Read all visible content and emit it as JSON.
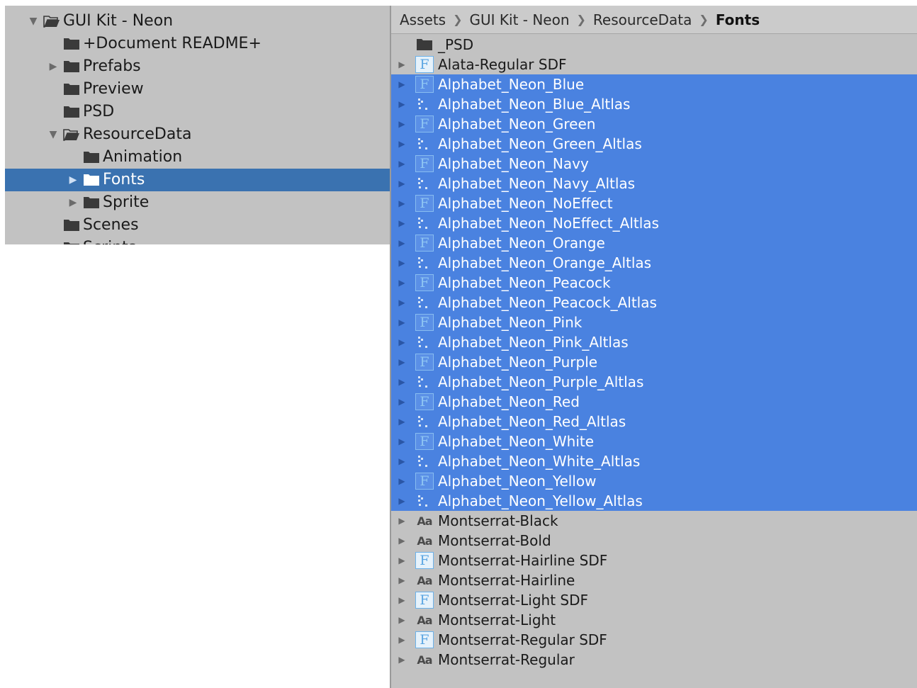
{
  "tree": {
    "items": [
      {
        "label": "GUI Kit - Neon",
        "indent": 0,
        "expander": "down",
        "open": true,
        "selected": false
      },
      {
        "label": "+Document README+",
        "indent": 1,
        "expander": "none",
        "open": false,
        "selected": false
      },
      {
        "label": "Prefabs",
        "indent": 1,
        "expander": "right",
        "open": false,
        "selected": false
      },
      {
        "label": "Preview",
        "indent": 1,
        "expander": "none",
        "open": false,
        "selected": false
      },
      {
        "label": "PSD",
        "indent": 1,
        "expander": "none",
        "open": false,
        "selected": false
      },
      {
        "label": "ResourceData",
        "indent": 1,
        "expander": "down",
        "open": true,
        "selected": false
      },
      {
        "label": "Animation",
        "indent": 2,
        "expander": "none",
        "open": false,
        "selected": false
      },
      {
        "label": "Fonts",
        "indent": 2,
        "expander": "right",
        "open": false,
        "selected": true
      },
      {
        "label": "Sprite",
        "indent": 2,
        "expander": "right",
        "open": false,
        "selected": false
      },
      {
        "label": "Scenes",
        "indent": 1,
        "expander": "none",
        "open": false,
        "selected": false
      },
      {
        "label": "Scripts",
        "indent": 1,
        "expander": "none",
        "open": false,
        "selected": false
      }
    ]
  },
  "breadcrumb": [
    "Assets",
    "GUI Kit - Neon",
    "ResourceData",
    "Fonts"
  ],
  "assets": [
    {
      "label": "_PSD",
      "icon": "folder-icon",
      "expander": false,
      "selected": false
    },
    {
      "label": "Alata-Regular SDF",
      "icon": "font-asset-icon",
      "expander": true,
      "selected": false
    },
    {
      "label": "Alphabet_Neon_Blue",
      "icon": "font-asset-icon",
      "expander": true,
      "selected": true
    },
    {
      "label": "Alphabet_Neon_Blue_Altlas",
      "icon": "atlas-texture-icon",
      "expander": true,
      "selected": true
    },
    {
      "label": "Alphabet_Neon_Green",
      "icon": "font-asset-icon",
      "expander": true,
      "selected": true
    },
    {
      "label": "Alphabet_Neon_Green_Altlas",
      "icon": "atlas-texture-icon",
      "expander": true,
      "selected": true
    },
    {
      "label": "Alphabet_Neon_Navy",
      "icon": "font-asset-icon",
      "expander": true,
      "selected": true
    },
    {
      "label": "Alphabet_Neon_Navy_Altlas",
      "icon": "atlas-texture-icon",
      "expander": true,
      "selected": true
    },
    {
      "label": "Alphabet_Neon_NoEffect",
      "icon": "font-asset-icon",
      "expander": true,
      "selected": true
    },
    {
      "label": "Alphabet_Neon_NoEffect_Altlas",
      "icon": "atlas-texture-icon",
      "expander": true,
      "selected": true
    },
    {
      "label": "Alphabet_Neon_Orange",
      "icon": "font-asset-icon",
      "expander": true,
      "selected": true
    },
    {
      "label": "Alphabet_Neon_Orange_Altlas",
      "icon": "atlas-texture-icon",
      "expander": true,
      "selected": true
    },
    {
      "label": "Alphabet_Neon_Peacock",
      "icon": "font-asset-icon",
      "expander": true,
      "selected": true
    },
    {
      "label": "Alphabet_Neon_Peacock_Altlas",
      "icon": "atlas-texture-icon",
      "expander": true,
      "selected": true
    },
    {
      "label": "Alphabet_Neon_Pink",
      "icon": "font-asset-icon",
      "expander": true,
      "selected": true
    },
    {
      "label": "Alphabet_Neon_Pink_Altlas",
      "icon": "atlas-texture-icon",
      "expander": true,
      "selected": true
    },
    {
      "label": "Alphabet_Neon_Purple",
      "icon": "font-asset-icon",
      "expander": true,
      "selected": true
    },
    {
      "label": "Alphabet_Neon_Purple_Altlas",
      "icon": "atlas-texture-icon",
      "expander": true,
      "selected": true
    },
    {
      "label": "Alphabet_Neon_Red",
      "icon": "font-asset-icon",
      "expander": true,
      "selected": true
    },
    {
      "label": "Alphabet_Neon_Red_Altlas",
      "icon": "atlas-texture-icon",
      "expander": true,
      "selected": true
    },
    {
      "label": "Alphabet_Neon_White",
      "icon": "font-asset-icon",
      "expander": true,
      "selected": true
    },
    {
      "label": "Alphabet_Neon_White_Altlas",
      "icon": "atlas-texture-icon",
      "expander": true,
      "selected": true
    },
    {
      "label": "Alphabet_Neon_Yellow",
      "icon": "font-asset-icon",
      "expander": true,
      "selected": true
    },
    {
      "label": "Alphabet_Neon_Yellow_Altlas",
      "icon": "atlas-texture-icon",
      "expander": true,
      "selected": true
    },
    {
      "label": "Montserrat-Black",
      "icon": "ttf-font-icon",
      "expander": true,
      "selected": false
    },
    {
      "label": "Montserrat-Bold",
      "icon": "ttf-font-icon",
      "expander": true,
      "selected": false
    },
    {
      "label": "Montserrat-Hairline SDF",
      "icon": "font-asset-icon",
      "expander": true,
      "selected": false
    },
    {
      "label": "Montserrat-Hairline",
      "icon": "ttf-font-icon",
      "expander": true,
      "selected": false
    },
    {
      "label": "Montserrat-Light SDF",
      "icon": "font-asset-icon",
      "expander": true,
      "selected": false
    },
    {
      "label": "Montserrat-Light",
      "icon": "ttf-font-icon",
      "expander": true,
      "selected": false
    },
    {
      "label": "Montserrat-Regular SDF",
      "icon": "font-asset-icon",
      "expander": true,
      "selected": false
    },
    {
      "label": "Montserrat-Regular",
      "icon": "ttf-font-icon",
      "expander": true,
      "selected": false
    }
  ],
  "icon_glyphs": {
    "font_asset": "F",
    "ttf_font": "Aa"
  },
  "colors": {
    "panel_bg": "#c2c2c2",
    "tree_selected": "#3a72b0",
    "list_selected": "#4a82e0",
    "font_asset_icon": "#5aa5e2"
  }
}
